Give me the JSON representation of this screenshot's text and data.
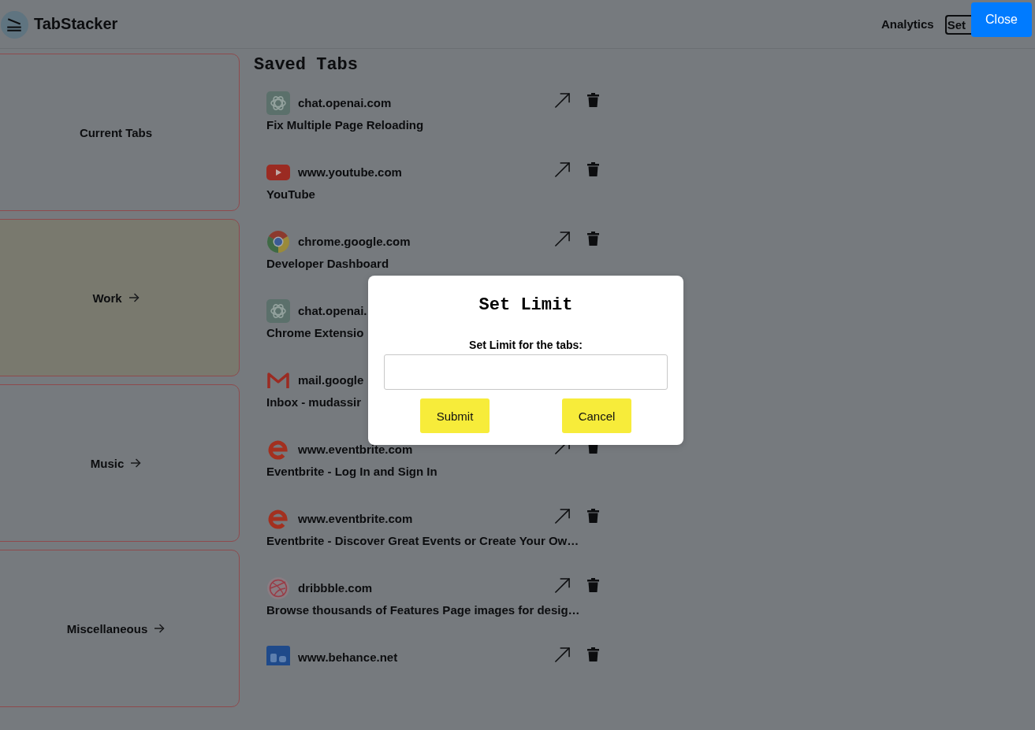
{
  "header": {
    "title": "TabStacker",
    "nav": [
      {
        "label": "Analytics",
        "kind": "link"
      },
      {
        "label": "Set",
        "kind": "button"
      }
    ]
  },
  "close_button": "Close",
  "sidebar": {
    "items": [
      {
        "label": "Current Tabs",
        "kind": "current",
        "selected": false
      },
      {
        "label": "Work",
        "kind": "group",
        "selected": true
      },
      {
        "label": "Music",
        "kind": "group",
        "selected": false
      },
      {
        "label": "Miscellaneous",
        "kind": "group",
        "selected": false
      }
    ]
  },
  "saved_tabs": {
    "title": "Saved Tabs",
    "items": [
      {
        "kind": "knot",
        "domain": "chat.openai.com",
        "title": "Fix Multiple Page Reloading"
      },
      {
        "kind": "play",
        "domain": "www.youtube.com",
        "title": "YouTube"
      },
      {
        "kind": "browser",
        "domain": "chrome.google.com",
        "title": "Developer Dashboard"
      },
      {
        "kind": "knot",
        "domain": "chat.openai.",
        "title": "Chrome Extensio"
      },
      {
        "kind": "mail",
        "domain": "mail.google",
        "title": "Inbox - mudassir"
      },
      {
        "kind": "e",
        "domain": "www.eventbrite.com",
        "title": "Eventbrite - Log In and Sign In"
      },
      {
        "kind": "e",
        "domain": "www.eventbrite.com",
        "title": "Eventbrite - Discover Great Events or Create Your Ow…"
      },
      {
        "kind": "ball",
        "domain": "dribbble.com",
        "title": "Browse thousands of Features Page images for desig…"
      },
      {
        "kind": "tile",
        "domain": "www.behance.net"
      }
    ]
  },
  "dialog": {
    "title": "Set Limit",
    "label": "Set Limit for the tabs:",
    "buttons": [
      "Submit",
      "Cancel"
    ]
  }
}
